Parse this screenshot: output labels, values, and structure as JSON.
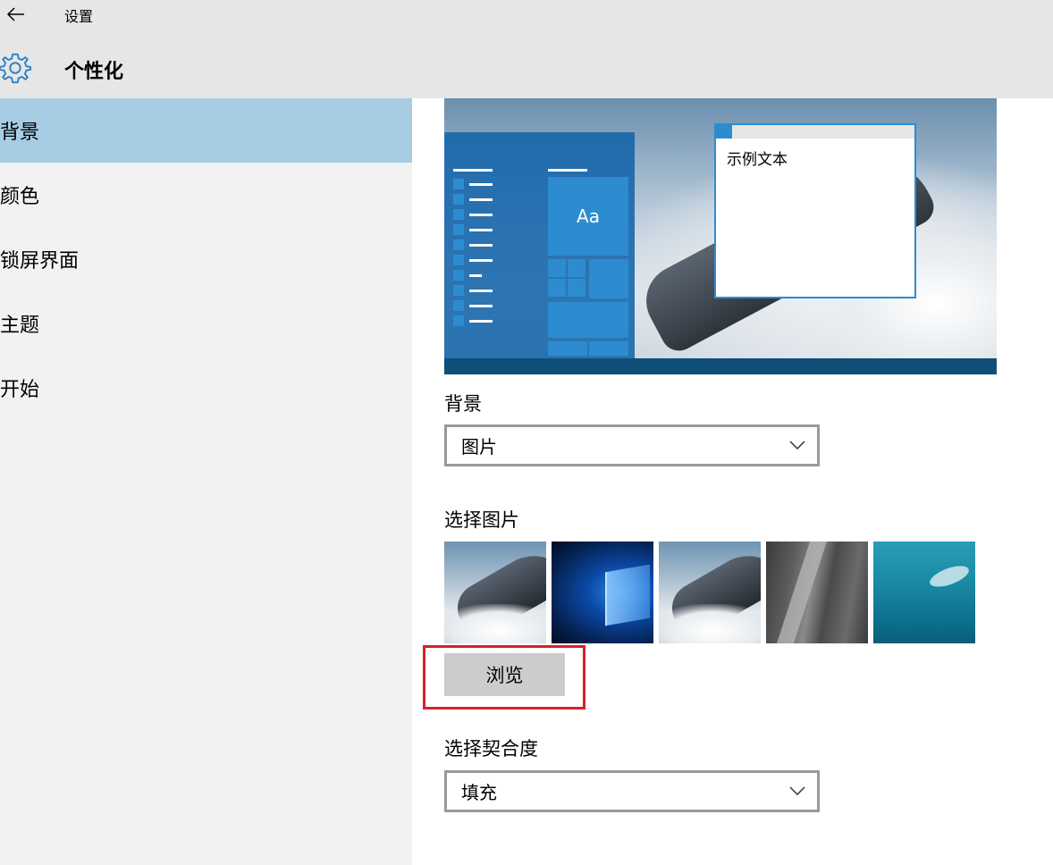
{
  "titlebar": {
    "back_icon": "back-arrow-icon",
    "app_title": "设置",
    "page_icon": "gear-icon",
    "page_title": "个性化"
  },
  "sidebar": {
    "items": [
      {
        "label": "背景",
        "active": true
      },
      {
        "label": "颜色",
        "active": false
      },
      {
        "label": "锁屏界面",
        "active": false
      },
      {
        "label": "主题",
        "active": false
      },
      {
        "label": "开始",
        "active": false
      }
    ],
    "active_color": "#a6cde4"
  },
  "preview": {
    "tile_text": "Aa",
    "sample_text": "示例文本",
    "accent_color": "#2d8cd0"
  },
  "background": {
    "label": "背景",
    "value": "图片"
  },
  "choose_picture": {
    "label": "选择图片",
    "thumbnails": [
      "jet-wallpaper",
      "windows10-wallpaper",
      "jet-wallpaper",
      "rock-wallpaper",
      "underwater-wallpaper"
    ],
    "browse_label": "浏览",
    "highlight_color": "#d9202a"
  },
  "fit": {
    "label": "选择契合度",
    "value": "填充"
  }
}
